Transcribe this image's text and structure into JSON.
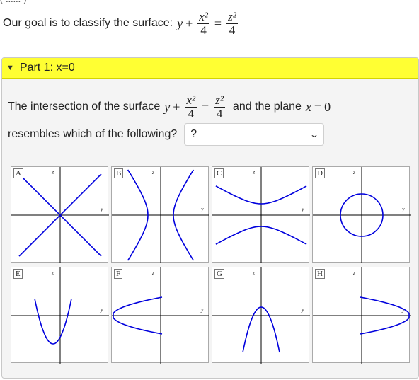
{
  "top_cut_text": "( ...... )",
  "goal": {
    "text": "Our goal is to classify the surface:",
    "lhs_var": "y",
    "plus": "+",
    "frac1_num": "x²",
    "frac1_den": "4",
    "equals": "=",
    "frac2_num": "z²",
    "frac2_den": "4"
  },
  "part": {
    "caret": "▼",
    "title": "Part 1: x=0"
  },
  "question": {
    "line1_text": "The intersection of the surface",
    "lhs_var": "y",
    "plus": "+",
    "frac1_num": "x²",
    "frac1_den": "4",
    "equals": "=",
    "frac2_num": "z²",
    "frac2_den": "4",
    "line1_suffix": "and the plane",
    "plane_var": "x",
    "plane_eq": "=",
    "plane_val": "0",
    "line2_text": "resembles which of the following?",
    "select_value": "?",
    "select_chevron": "⌄"
  },
  "options": [
    {
      "label": "A",
      "ax_v": "z",
      "ax_h": "y",
      "curve": "lines-x"
    },
    {
      "label": "B",
      "ax_v": "z",
      "ax_h": "y",
      "curve": "hyperbola-lr"
    },
    {
      "label": "C",
      "ax_v": "z",
      "ax_h": "y",
      "curve": "hyperbola-ud"
    },
    {
      "label": "D",
      "ax_v": "z",
      "ax_h": "y",
      "curve": "circle"
    },
    {
      "label": "E",
      "ax_v": "z",
      "ax_h": "y",
      "curve": "parabola-up"
    },
    {
      "label": "F",
      "ax_v": "z",
      "ax_h": "y",
      "curve": "parabola-right"
    },
    {
      "label": "G",
      "ax_v": "z",
      "ax_h": "y",
      "curve": "parabola-down"
    },
    {
      "label": "H",
      "ax_v": "z",
      "ax_h": "y",
      "curve": "parabola-left"
    }
  ],
  "colors": {
    "curve": "#0000dd",
    "header": "#ffff33"
  }
}
